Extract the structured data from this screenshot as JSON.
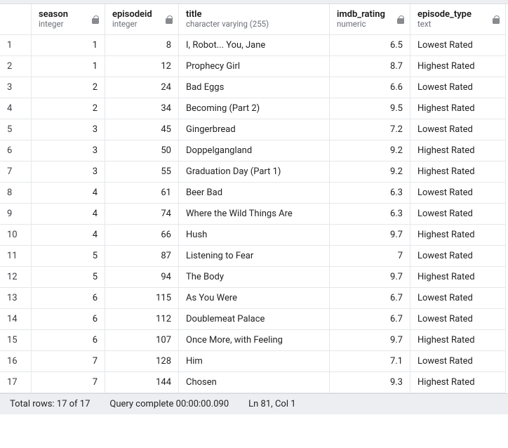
{
  "columns": [
    {
      "name": "season",
      "type": "integer",
      "align": "num",
      "locked": true
    },
    {
      "name": "episodeid",
      "type": "integer",
      "align": "num",
      "locked": true
    },
    {
      "name": "title",
      "type": "character varying (255)",
      "align": "txt",
      "locked": false
    },
    {
      "name": "imdb_rating",
      "type": "numeric",
      "align": "num",
      "locked": true
    },
    {
      "name": "episode_type",
      "type": "text",
      "align": "txt",
      "locked": true
    }
  ],
  "rows": [
    {
      "n": "1",
      "season": "1",
      "episodeid": "8",
      "title": "I, Robot... You, Jane",
      "imdb_rating": "6.5",
      "episode_type": "Lowest Rated"
    },
    {
      "n": "2",
      "season": "1",
      "episodeid": "12",
      "title": "Prophecy Girl",
      "imdb_rating": "8.7",
      "episode_type": "Highest Rated"
    },
    {
      "n": "3",
      "season": "2",
      "episodeid": "24",
      "title": "Bad Eggs",
      "imdb_rating": "6.6",
      "episode_type": "Lowest Rated"
    },
    {
      "n": "4",
      "season": "2",
      "episodeid": "34",
      "title": "Becoming (Part 2)",
      "imdb_rating": "9.5",
      "episode_type": "Highest Rated"
    },
    {
      "n": "5",
      "season": "3",
      "episodeid": "45",
      "title": "Gingerbread",
      "imdb_rating": "7.2",
      "episode_type": "Lowest Rated"
    },
    {
      "n": "6",
      "season": "3",
      "episodeid": "50",
      "title": "Doppelgangland",
      "imdb_rating": "9.2",
      "episode_type": "Highest Rated"
    },
    {
      "n": "7",
      "season": "3",
      "episodeid": "55",
      "title": "Graduation Day (Part 1)",
      "imdb_rating": "9.2",
      "episode_type": "Highest Rated"
    },
    {
      "n": "8",
      "season": "4",
      "episodeid": "61",
      "title": "Beer Bad",
      "imdb_rating": "6.3",
      "episode_type": "Lowest Rated"
    },
    {
      "n": "9",
      "season": "4",
      "episodeid": "74",
      "title": "Where the Wild Things Are",
      "imdb_rating": "6.3",
      "episode_type": "Lowest Rated"
    },
    {
      "n": "10",
      "season": "4",
      "episodeid": "66",
      "title": "Hush",
      "imdb_rating": "9.7",
      "episode_type": "Highest Rated"
    },
    {
      "n": "11",
      "season": "5",
      "episodeid": "87",
      "title": "Listening to Fear",
      "imdb_rating": "7",
      "episode_type": "Lowest Rated"
    },
    {
      "n": "12",
      "season": "5",
      "episodeid": "94",
      "title": "The Body",
      "imdb_rating": "9.7",
      "episode_type": "Highest Rated"
    },
    {
      "n": "13",
      "season": "6",
      "episodeid": "115",
      "title": "As You Were",
      "imdb_rating": "6.7",
      "episode_type": "Lowest Rated"
    },
    {
      "n": "14",
      "season": "6",
      "episodeid": "112",
      "title": "Doublemeat Palace",
      "imdb_rating": "6.7",
      "episode_type": "Lowest Rated"
    },
    {
      "n": "15",
      "season": "6",
      "episodeid": "107",
      "title": "Once More, with Feeling",
      "imdb_rating": "9.7",
      "episode_type": "Highest Rated"
    },
    {
      "n": "16",
      "season": "7",
      "episodeid": "128",
      "title": "Him",
      "imdb_rating": "7.1",
      "episode_type": "Lowest Rated"
    },
    {
      "n": "17",
      "season": "7",
      "episodeid": "144",
      "title": "Chosen",
      "imdb_rating": "9.3",
      "episode_type": "Highest Rated"
    }
  ],
  "status": {
    "total_rows": "Total rows: 17 of 17",
    "query_time": "Query complete 00:00:00.090",
    "cursor": "Ln 81, Col 1"
  },
  "chart_data": {
    "type": "table",
    "columns": [
      "season",
      "episodeid",
      "title",
      "imdb_rating",
      "episode_type"
    ],
    "rows": [
      [
        1,
        8,
        "I, Robot... You, Jane",
        6.5,
        "Lowest Rated"
      ],
      [
        1,
        12,
        "Prophecy Girl",
        8.7,
        "Highest Rated"
      ],
      [
        2,
        24,
        "Bad Eggs",
        6.6,
        "Lowest Rated"
      ],
      [
        2,
        34,
        "Becoming (Part 2)",
        9.5,
        "Highest Rated"
      ],
      [
        3,
        45,
        "Gingerbread",
        7.2,
        "Lowest Rated"
      ],
      [
        3,
        50,
        "Doppelgangland",
        9.2,
        "Highest Rated"
      ],
      [
        3,
        55,
        "Graduation Day (Part 1)",
        9.2,
        "Highest Rated"
      ],
      [
        4,
        61,
        "Beer Bad",
        6.3,
        "Lowest Rated"
      ],
      [
        4,
        74,
        "Where the Wild Things Are",
        6.3,
        "Lowest Rated"
      ],
      [
        4,
        66,
        "Hush",
        9.7,
        "Highest Rated"
      ],
      [
        5,
        87,
        "Listening to Fear",
        7,
        "Lowest Rated"
      ],
      [
        5,
        94,
        "The Body",
        9.7,
        "Highest Rated"
      ],
      [
        6,
        115,
        "As You Were",
        6.7,
        "Lowest Rated"
      ],
      [
        6,
        112,
        "Doublemeat Palace",
        6.7,
        "Lowest Rated"
      ],
      [
        6,
        107,
        "Once More, with Feeling",
        9.7,
        "Highest Rated"
      ],
      [
        7,
        128,
        "Him",
        7.1,
        "Lowest Rated"
      ],
      [
        7,
        144,
        "Chosen",
        9.3,
        "Highest Rated"
      ]
    ]
  }
}
